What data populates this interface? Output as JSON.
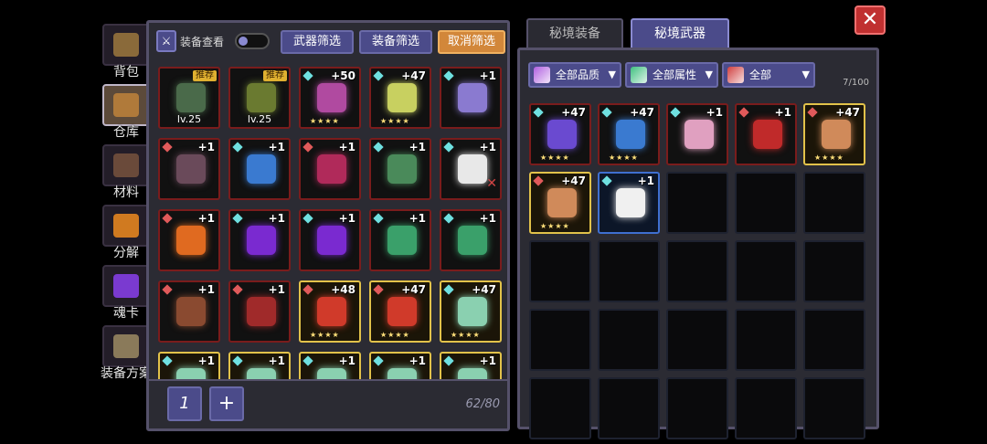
{
  "side_tabs": [
    {
      "label": "背包",
      "icon": "backpack-icon",
      "active": false
    },
    {
      "label": "仓库",
      "icon": "storage-chest-icon",
      "active": true
    },
    {
      "label": "材料",
      "icon": "materials-icon",
      "active": false
    },
    {
      "label": "分解",
      "icon": "decompose-icon",
      "active": false
    },
    {
      "label": "魂卡",
      "icon": "soul-card-icon",
      "active": false
    },
    {
      "label": "装备方案",
      "icon": "loadout-icon",
      "active": false
    }
  ],
  "left_panel": {
    "view_label": "装备查看",
    "buttons": {
      "weapon_filter": "武器筛选",
      "equip_filter": "装备筛选",
      "cancel_filter": "取消筛选"
    },
    "page_button": "1",
    "add_button": "+",
    "capacity": "62/80",
    "items": [
      {
        "badge": "推荐",
        "lv": "lv.25",
        "color": "#4a6a4a",
        "style": "red"
      },
      {
        "badge": "推荐",
        "lv": "lv.25",
        "color": "#6a7a30",
        "style": "red"
      },
      {
        "plus": "+50",
        "stars": "★★★★",
        "color": "#b04aa0",
        "style": "red",
        "gem": "#6fe0e0"
      },
      {
        "plus": "+47",
        "stars": "★★★★",
        "color": "#c8d060",
        "style": "red",
        "gem": "#6fe0e0"
      },
      {
        "plus": "+1",
        "color": "#8a7ad0",
        "style": "red",
        "gem": "#6fe0e0"
      },
      {
        "plus": "+1",
        "color": "#6a4a5a",
        "style": "red",
        "gem": "#e05a5a"
      },
      {
        "plus": "+1",
        "color": "#3a7ad0",
        "style": "red",
        "gem": "#6fe0e0"
      },
      {
        "plus": "+1",
        "color": "#b02a5a",
        "style": "red",
        "gem": "#e05a5a"
      },
      {
        "plus": "+1",
        "color": "#4a8a5a",
        "style": "red",
        "gem": "#6fe0e0"
      },
      {
        "plus": "+1",
        "color": "#e8e8e8",
        "style": "red",
        "gem": "#6fe0e0",
        "x": "✕"
      },
      {
        "plus": "+1",
        "color": "#e06a20",
        "style": "red",
        "gem": "#e05a5a"
      },
      {
        "plus": "+1",
        "color": "#7a2ad0",
        "style": "red",
        "gem": "#6fe0e0"
      },
      {
        "plus": "+1",
        "color": "#7a2ad0",
        "style": "red",
        "gem": "#6fe0e0"
      },
      {
        "plus": "+1",
        "color": "#3aa06a",
        "style": "red",
        "gem": "#6fe0e0"
      },
      {
        "plus": "+1",
        "color": "#3aa06a",
        "style": "red",
        "gem": "#6fe0e0"
      },
      {
        "plus": "+1",
        "color": "#8a4a30",
        "style": "red",
        "gem": "#e05a5a"
      },
      {
        "plus": "+1",
        "color": "#a02a2a",
        "style": "red",
        "gem": "#e05a5a"
      },
      {
        "plus": "+48",
        "stars": "★★★★",
        "color": "#d03a2a",
        "style": "gold",
        "gem": "#e05a5a"
      },
      {
        "plus": "+47",
        "stars": "★★★★",
        "color": "#d03a2a",
        "style": "gold",
        "gem": "#e05a5a"
      },
      {
        "plus": "+47",
        "stars": "★★★★",
        "color": "#8ad0b0",
        "style": "gold",
        "gem": "#6fe0e0"
      },
      {
        "plus": "+1",
        "color": "#8ad0b0",
        "style": "gold",
        "gem": "#6fe0e0"
      },
      {
        "plus": "+1",
        "color": "#8ad0b0",
        "style": "gold",
        "gem": "#6fe0e0"
      },
      {
        "plus": "+1",
        "color": "#8ad0b0",
        "style": "gold",
        "gem": "#6fe0e0"
      },
      {
        "plus": "+1",
        "color": "#8ad0b0",
        "style": "gold",
        "gem": "#6fe0e0"
      },
      {
        "plus": "+1",
        "color": "#8ad0b0",
        "style": "gold",
        "gem": "#6fe0e0"
      }
    ]
  },
  "right_panel": {
    "tabs": [
      {
        "label": "秘境装备",
        "active": false
      },
      {
        "label": "秘境武器",
        "active": true
      }
    ],
    "filters": [
      {
        "label": "全部品质",
        "swatch": "#b060e0"
      },
      {
        "label": "全部属性",
        "swatch": "#40c080"
      },
      {
        "label": "全部",
        "swatch": "#d04040"
      }
    ],
    "dropdown_glyph": "▼",
    "capacity": "7/100",
    "items": [
      {
        "plus": "+47",
        "stars": "★★★★",
        "color": "#6a4ad0",
        "style": "red",
        "gem": "#6fe0e0"
      },
      {
        "plus": "+47",
        "stars": "★★★★",
        "color": "#3a7ad0",
        "style": "red",
        "gem": "#6fe0e0"
      },
      {
        "plus": "+1",
        "color": "#e0a0c0",
        "style": "red",
        "gem": "#6fe0e0"
      },
      {
        "plus": "+1",
        "color": "#c02a2a",
        "style": "red",
        "gem": "#e05a5a"
      },
      {
        "plus": "+47",
        "stars": "★★★★",
        "color": "#d08a5a",
        "style": "gold",
        "gem": "#e05a5a"
      },
      {
        "plus": "+47",
        "stars": "★★★★",
        "color": "#d08a5a",
        "style": "gold",
        "gem": "#e05a5a"
      },
      {
        "plus": "+1",
        "color": "#f0f0f0",
        "style": "blue",
        "gem": "#6fe0e0"
      }
    ],
    "total_slots": 25
  },
  "close_glyph": "✕"
}
